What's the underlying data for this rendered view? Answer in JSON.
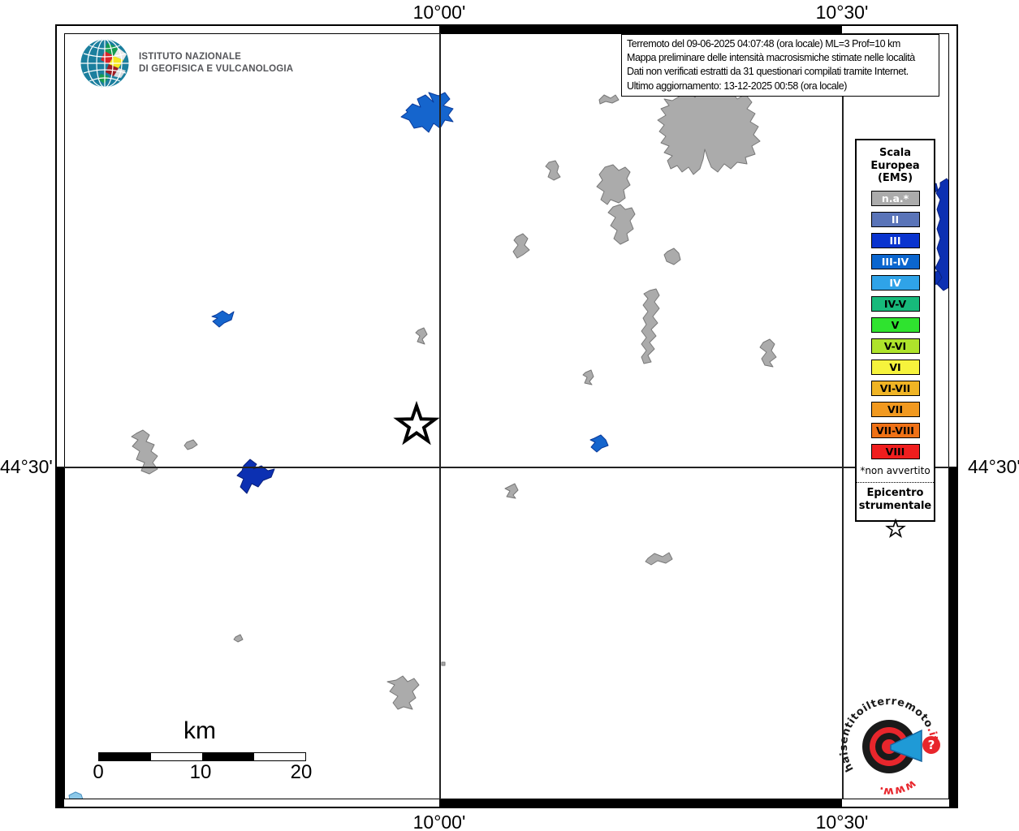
{
  "branding": {
    "ingv_line1": "ISTITUTO NAZIONALE",
    "ingv_line2": "DI GEOFISICA E VULCANOLOGIA"
  },
  "title_box": {
    "line1": "Terremoto del 09-06-2025 04:07:48 (ora locale) ML=3 Prof=10 km",
    "line2": "Mappa preliminare delle intensità macrosismiche stimate nelle località",
    "line3": "Dati non verificati estratti da 31 questionari compilati tramite Internet.",
    "line4": "Ultimo aggiornamento: 13-12-2025 00:58 (ora locale)"
  },
  "axes": {
    "top": [
      "10°00'",
      "10°30'"
    ],
    "bottom": [
      "10°00'",
      "10°30'"
    ],
    "left": "44°30'",
    "right": "44°30'"
  },
  "legend": {
    "title_lines": [
      "Scala",
      "Europea",
      "(EMS)"
    ],
    "items": [
      {
        "label": "n.a.*",
        "color": "#ABABAB",
        "text": "#FFFFFF"
      },
      {
        "label": "II",
        "color": "#5A74B8",
        "text": "#FFFFFF"
      },
      {
        "label": "III",
        "color": "#0A34CF",
        "text": "#FFFFFF"
      },
      {
        "label": "III-IV",
        "color": "#0B66CF",
        "text": "#FFFFFF"
      },
      {
        "label": "IV",
        "color": "#2FA3E8",
        "text": "#FFFFFF"
      },
      {
        "label": "IV-V",
        "color": "#17BA7B",
        "text": "#000000"
      },
      {
        "label": "V",
        "color": "#2FE32F",
        "text": "#000000"
      },
      {
        "label": "V-VI",
        "color": "#AEE32B",
        "text": "#000000"
      },
      {
        "label": "VI",
        "color": "#F6F33C",
        "text": "#000000"
      },
      {
        "label": "VI-VII",
        "color": "#F0B424",
        "text": "#000000"
      },
      {
        "label": "VII",
        "color": "#F1991F",
        "text": "#000000"
      },
      {
        "label": "VII-VIII",
        "color": "#EF7116",
        "text": "#000000"
      },
      {
        "label": "VIII",
        "color": "#F01E1E",
        "text": "#000000"
      }
    ],
    "footnote": "*non avvertito",
    "epicenter_lines": [
      "Epicentro",
      "strumentale"
    ]
  },
  "scalebar": {
    "unit": "km",
    "ticks": [
      "0",
      "10",
      "20"
    ]
  },
  "watermark": {
    "text_main": "haisentitoilterremoto",
    "text_suffix": ".it",
    "text_www": "www.",
    "question_mark": "?"
  },
  "map": {
    "colors": {
      "na": "#ABABAB",
      "blue_medium": "#1565CD",
      "blue_dark": "#0C30B2",
      "blue_light": "#8CC8E8",
      "epicenter_fill": "#FFFFFF"
    }
  }
}
